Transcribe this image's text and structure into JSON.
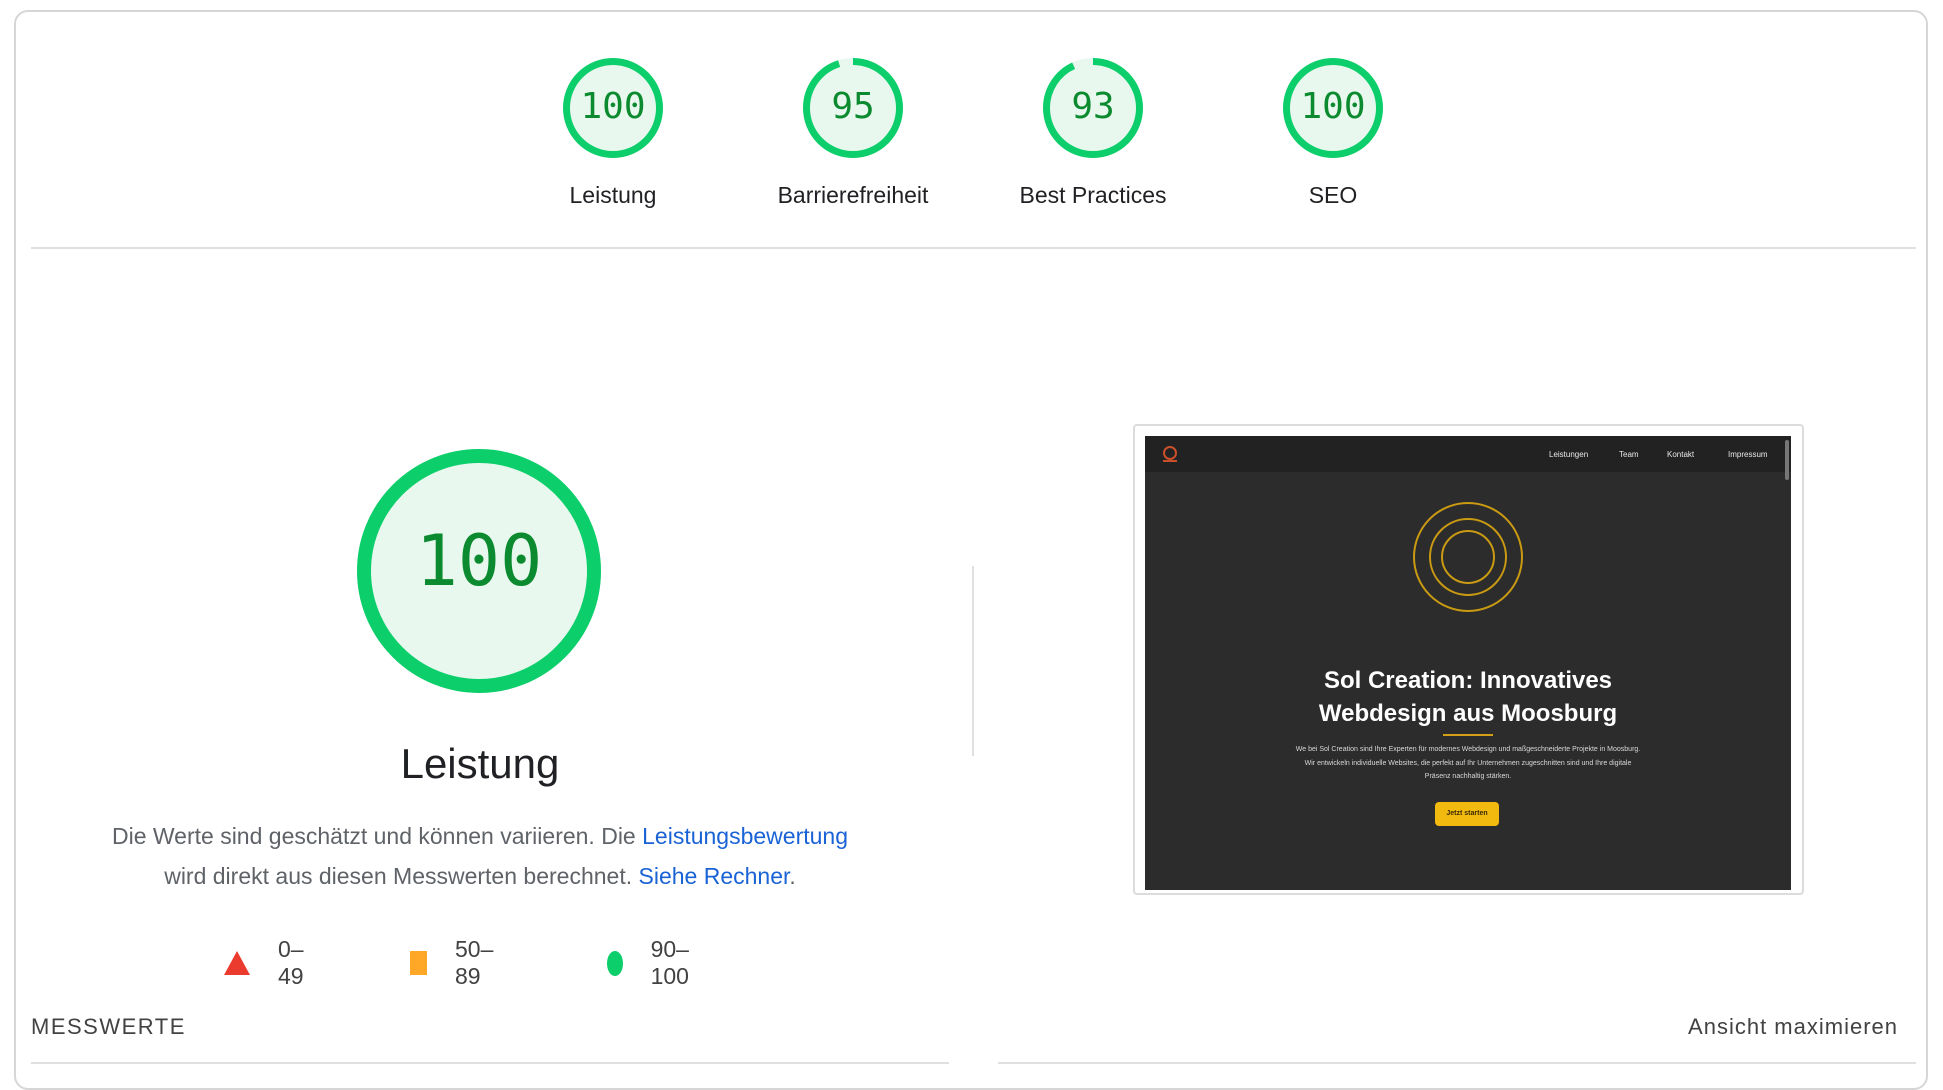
{
  "colors": {
    "pass": "#0cce6b",
    "pass_text": "#0b8a2f",
    "pass_fill": "#e8f8ee",
    "average": "#ffa726",
    "fail": "#eb3b2f",
    "link": "#1a63d6"
  },
  "categories": [
    {
      "score": 100,
      "label": "Leistung"
    },
    {
      "score": 95,
      "label": "Barrierefreiheit"
    },
    {
      "score": 93,
      "label": "Best Practices"
    },
    {
      "score": 100,
      "label": "SEO"
    }
  ],
  "main": {
    "score": 100,
    "title": "Leistung",
    "desc_part1": "Die Werte sind geschätzt und können variieren. Die ",
    "desc_link1": "Leistungsbewertung",
    "desc_part2": " wird direkt aus diesen Messwerten berechnet. ",
    "desc_link2": "Siehe Rechner",
    "desc_part3": "."
  },
  "legend": {
    "fail_range": "0–49",
    "average_range": "50–89",
    "pass_range": "90–100",
    "fail_icon": "triangle-icon",
    "average_icon": "square-icon",
    "pass_icon": "circle-icon"
  },
  "screenshot": {
    "nav": [
      "Leistungen",
      "Team",
      "Kontakt",
      "Impressum"
    ],
    "headline_line1": "Sol Creation: Innovatives",
    "headline_line2": "Webdesign aus Moosburg",
    "paragraph": "We bei Sol Creation sind Ihre Experten für modernes Webdesign und maßgeschneiderte Projekte in Moosburg. Wir entwickeln individuelle Websites, die perfekt auf Ihr Unternehmen zugeschnitten sind und Ihre digitale Präsenz nachhaltig stärken.",
    "button": "Jetzt starten"
  },
  "footer": {
    "section_label": "MESSWERTE",
    "expand_label": "Ansicht maximieren"
  }
}
